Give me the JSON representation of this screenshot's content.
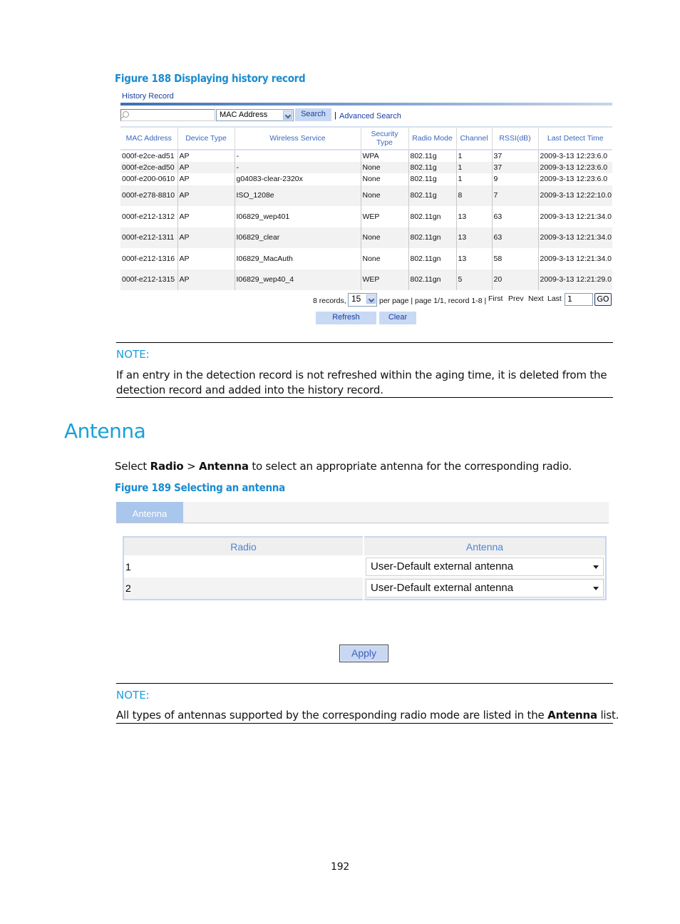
{
  "figure188": {
    "caption": "Figure 188 Displaying history record",
    "panel_title": "History Record",
    "search": {
      "input_value": "",
      "field_select": "MAC Address",
      "search_label": "Search",
      "separator": "|",
      "advanced_label": "Advanced Search"
    },
    "table": {
      "headers": [
        "MAC Address",
        "Device Type",
        "Wireless Service",
        "Security Type",
        "Radio Mode",
        "Channel",
        "RSSI(dB)",
        "Last Detect Time"
      ],
      "rows": [
        [
          "000f-e2ce-ad51",
          "AP",
          "-",
          "WPA",
          "802.11g",
          "1",
          "37",
          "2009-3-13 12:23:6.0"
        ],
        [
          "000f-e2ce-ad50",
          "AP",
          "-",
          "None",
          "802.11g",
          "1",
          "37",
          "2009-3-13 12:23:6.0"
        ],
        [
          "000f-e200-0610",
          "AP",
          "g04083-clear-2320x",
          "None",
          "802.11g",
          "1",
          "9",
          "2009-3-13 12:23:6.0"
        ],
        [
          "000f-e278-8810",
          "AP",
          "ISO_1208e",
          "None",
          "802.11g",
          "8",
          "7",
          "2009-3-13 12:22:10.0"
        ],
        [
          "000f-e212-1312",
          "AP",
          "I06829_wep401",
          "WEP",
          "802.11gn",
          "13",
          "63",
          "2009-3-13 12:21:34.0"
        ],
        [
          "000f-e212-1311",
          "AP",
          "I06829_clear",
          "None",
          "802.11gn",
          "13",
          "63",
          "2009-3-13 12:21:34.0"
        ],
        [
          "000f-e212-1316",
          "AP",
          "I06829_MacAuth",
          "None",
          "802.11gn",
          "13",
          "58",
          "2009-3-13 12:21:34.0"
        ],
        [
          "000f-e212-1315",
          "AP",
          "I06829_wep40_4",
          "WEP",
          "802.11gn",
          "5",
          "20",
          "2009-3-13 12:21:29.0"
        ]
      ]
    },
    "pager": {
      "records_text": "8 records,",
      "per_page_value": "15",
      "per_page_text": "per page | page 1/1, record 1-8 |",
      "first": "First",
      "prev": "Prev",
      "next": "Next",
      "last": "Last",
      "page_input": "1",
      "go_label": "GO"
    },
    "buttons": {
      "refresh": "Refresh",
      "clear": "Clear"
    }
  },
  "note1": {
    "label": "NOTE:",
    "text": "If an entry in the detection record is not refreshed within the aging time, it is deleted from the detection record and added into the history record."
  },
  "section": {
    "heading": "Antenna",
    "intro_pre": "Select ",
    "intro_b1": "Radio",
    "intro_mid": " > ",
    "intro_b2": "Antenna",
    "intro_post": " to select an appropriate antenna for the corresponding radio."
  },
  "figure189": {
    "caption": "Figure 189 Selecting an antenna",
    "tab_label": "Antenna",
    "headers": [
      "Radio",
      "Antenna"
    ],
    "rows": [
      {
        "radio": "1",
        "antenna": "User-Default external antenna"
      },
      {
        "radio": "2",
        "antenna": "User-Default external antenna"
      }
    ],
    "apply_label": "Apply"
  },
  "note2": {
    "label": "NOTE:",
    "text_pre": "All types of antennas supported by the corresponding radio mode are listed in the ",
    "text_bold": "Antenna",
    "text_post": " list."
  },
  "page_number": "192"
}
